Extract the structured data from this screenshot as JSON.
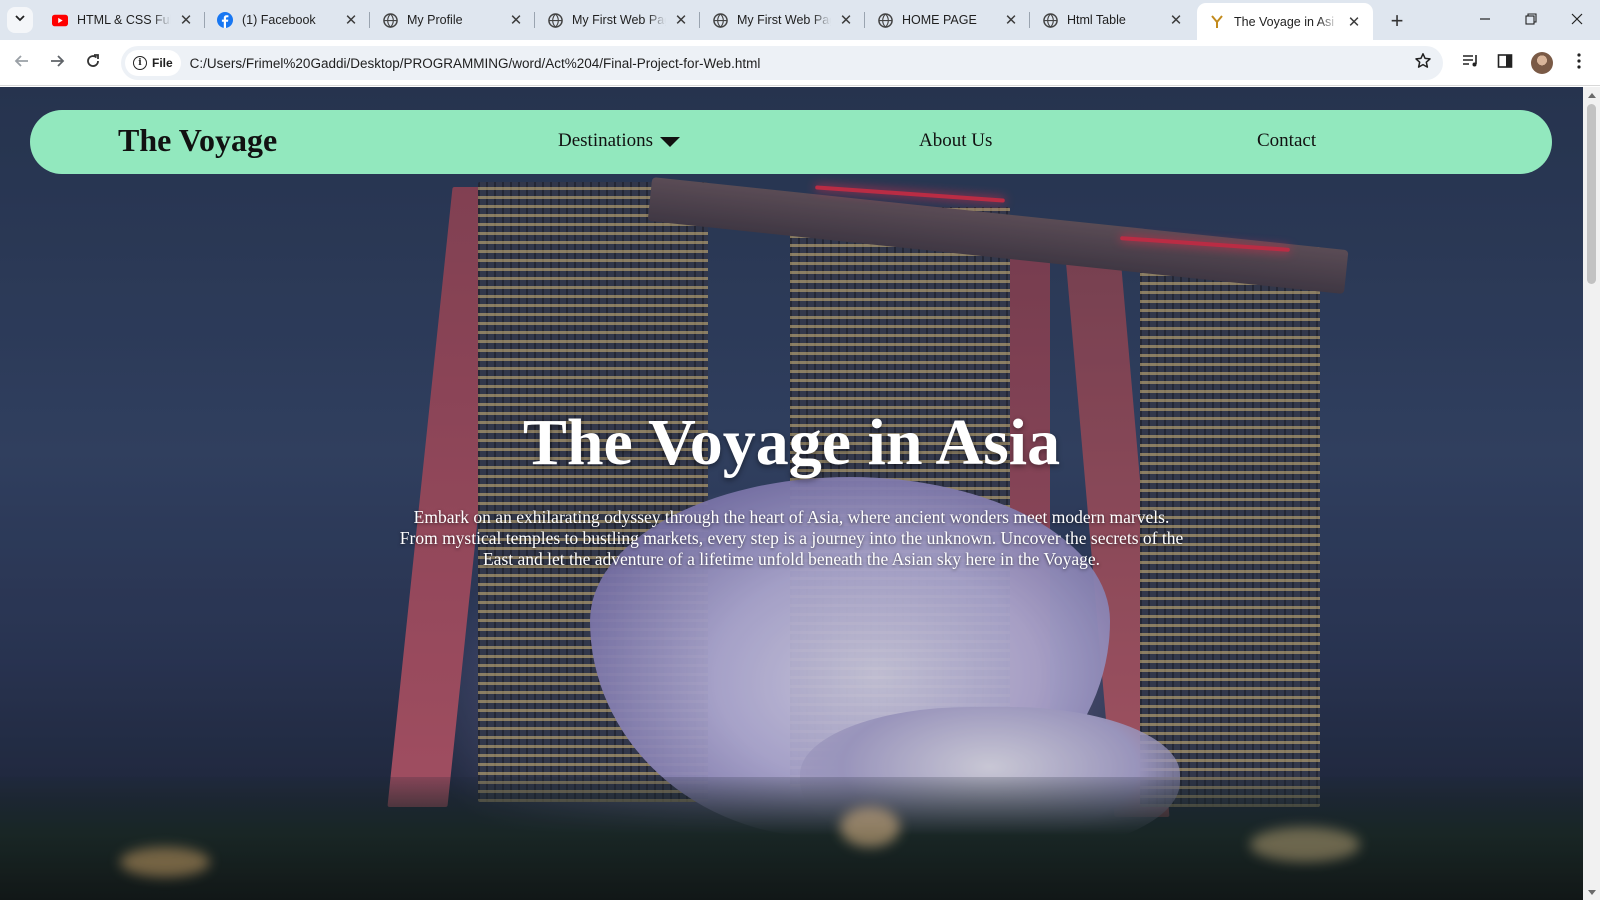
{
  "browser": {
    "tabs": [
      {
        "title": "HTML & CSS Full C",
        "icon": "youtube-icon",
        "active": false
      },
      {
        "title": "(1) Facebook",
        "icon": "facebook-icon",
        "active": false
      },
      {
        "title": "My Profile",
        "icon": "globe-icon",
        "active": false
      },
      {
        "title": "My First Web Page",
        "icon": "globe-icon",
        "active": false
      },
      {
        "title": "My First Web Page",
        "icon": "globe-icon",
        "active": false
      },
      {
        "title": "HOME PAGE",
        "icon": "globe-icon",
        "active": false
      },
      {
        "title": "Html Table",
        "icon": "globe-icon",
        "active": false
      },
      {
        "title": "The Voyage in Asi",
        "icon": "site-y-icon",
        "active": true
      }
    ],
    "address_chip": "File",
    "url": "C:/Users/Frimel%20Gaddi/Desktop/PROGRAMMING/word/Act%204/Final-Project-for-Web.html"
  },
  "site": {
    "brand": "The Voyage",
    "nav": {
      "destinations": "Destinations",
      "about": "About Us",
      "contact": "Contact"
    },
    "hero": {
      "title": "The Voyage in Asia",
      "text": "Embark on an exhilarating odyssey through the heart of Asia, where ancient wonders meet modern marvels. From mystical temples to bustling markets, every step is a journey into the unknown. Uncover the secrets of the East and let the adventure of a lifetime unfold beneath the Asian sky here in the Voyage."
    },
    "colors": {
      "nav_background": "#92e8be",
      "hero_text": "#ffffff"
    }
  }
}
